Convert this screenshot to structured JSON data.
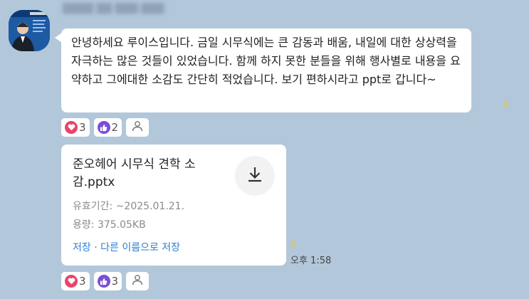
{
  "message": {
    "sender_name": "████ ██ ███ ███",
    "text": "안녕하세요 루이스입니다. 금일 시무식에는 큰 감동과 배움, 내일에 대한 상상력을 자극하는 많은 것들이 있었습니다. 함께 하지 못한 분들을 위해 행사별로 내용을 요약하고 그에대한 소감도 간단히 적었습니다. 보기 편하시라고 ppt로 갑니다~",
    "unread_count": "9",
    "reactions": {
      "heart_count": "3",
      "like_count": "2"
    }
  },
  "file": {
    "name": "준오헤어 시무식 견학 소감.pptx",
    "expiry_label": "유효기간:",
    "expiry_value": "~2025.01.21.",
    "size_label": "용량:",
    "size_value": "375.05KB",
    "save_label": "저장",
    "separator": "·",
    "save_as_label": "다른 이름으로 저장",
    "unread_count": "9",
    "time": "오후 1:58",
    "reactions": {
      "heart_count": "3",
      "like_count": "3"
    }
  },
  "colors": {
    "background": "#b2c7da",
    "heart": "#e8456a",
    "like": "#7a4fd6",
    "link": "#2e7fd1",
    "unread": "#e3c84a"
  },
  "icons": [
    "heart-icon",
    "thumbs-up-icon",
    "person-icon",
    "download-icon"
  ]
}
